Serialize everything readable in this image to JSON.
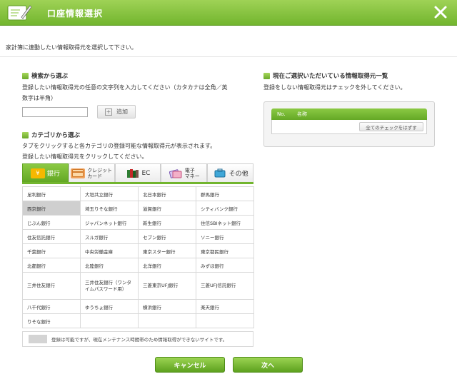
{
  "window": {
    "title": "口座情報選択"
  },
  "intro": "家計簿に連動したい情報取得元を選択して下さい。",
  "search": {
    "heading": "検索から選ぶ",
    "desc_line1": "登録したい情報取得元の任意の文字列を入力してください（カタカナは全角／英",
    "desc_line2": "数字は半角）",
    "input_value": "",
    "add_label": "追加"
  },
  "category": {
    "heading": "カテゴリから選ぶ",
    "desc_line1": "タブをクリックすると各カテゴリの登録可能な情報取得元が表示されます。",
    "desc_line2": "登録したい情報取得元をクリックしてください。",
    "tabs": [
      {
        "label": "銀行",
        "icon": "yen-icon",
        "active": true
      },
      {
        "label": "クレジット カード",
        "line1": "クレジット",
        "line2": "カード",
        "icon": "credit-card-icon",
        "active": false
      },
      {
        "label": "EC",
        "icon": "books-icon",
        "active": false
      },
      {
        "label": "電子 マネー",
        "line1": "電子",
        "line2": "マネー",
        "icon": "emoney-icon",
        "active": false
      },
      {
        "label": "その他",
        "icon": "briefcase-icon",
        "active": false
      }
    ],
    "rows": [
      [
        "足利銀行",
        "大垣共立銀行",
        "北日本銀行",
        "群馬銀行"
      ],
      [
        "西京銀行",
        "埼玉りそな銀行",
        "滋賀銀行",
        "シティバンク銀行"
      ],
      [
        "じぶん銀行",
        "ジャパンネット銀行",
        "新生銀行",
        "住信SBIネット銀行"
      ],
      [
        "住友信託銀行",
        "スルガ銀行",
        "セブン銀行",
        "ソニー銀行"
      ],
      [
        "千葉銀行",
        "中央労働金庫",
        "東京スター銀行",
        "東京都民銀行"
      ],
      [
        "北都銀行",
        "北陸銀行",
        "北洋銀行",
        "みずほ銀行"
      ],
      [
        "三井住友銀行",
        "三井住友銀行（ワンタイムパスワード用）",
        "三菱東京UFJ銀行",
        "三菱UFJ信託銀行"
      ],
      [
        "八千代銀行",
        "ゆうちょ銀行",
        "横浜銀行",
        "楽天銀行"
      ],
      [
        "りそな銀行",
        "",
        "",
        ""
      ]
    ],
    "selected_bank": "西京銀行",
    "legend": "登録は可能ですが、現在メンテナンス時間帯のため情報取得ができないサイトです。"
  },
  "current": {
    "heading": "現在ご選択いただいている情報取得元一覧",
    "desc": "登録をしない情報取得元はチェックを外してください。",
    "col_no": "No.",
    "col_name": "名称",
    "uncheck_all": "全てのチェックをはずす"
  },
  "buttons": {
    "cancel": "キャンセル",
    "next": "次へ"
  },
  "colors": {
    "accent": "#72b52e",
    "selected_cell": "#cfcfcf"
  }
}
